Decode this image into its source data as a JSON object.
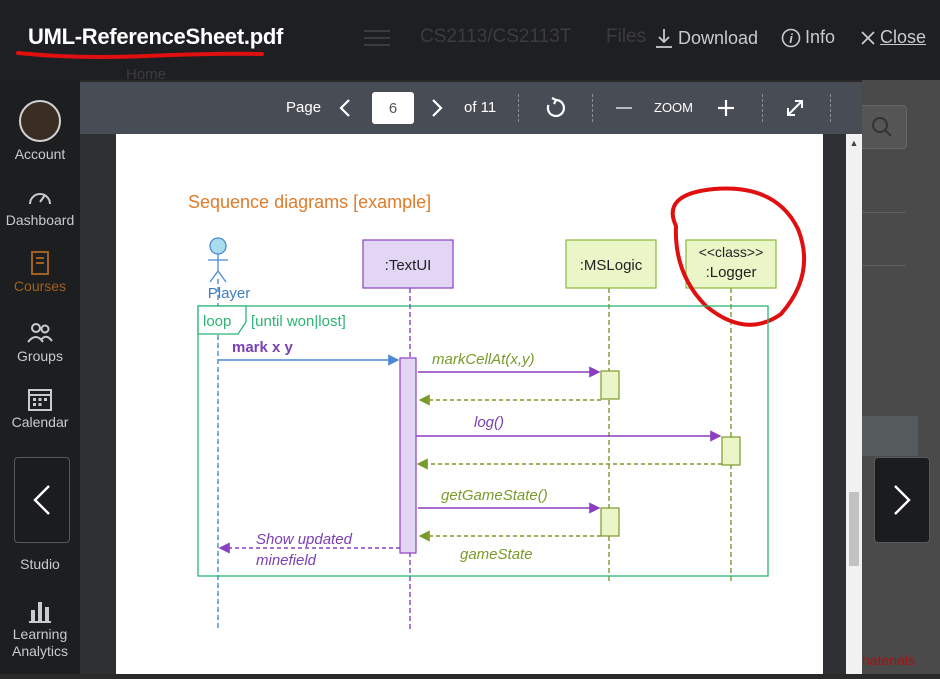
{
  "header": {
    "file_title": "UML-ReferenceSheet.pdf",
    "course_crumb": "CS2113/CS2113T",
    "crumb_files": "Files",
    "home_crumb": "Home",
    "download_label": "Download",
    "info_label": "Info",
    "close_label": "Close"
  },
  "sidebar": {
    "items": [
      {
        "label": "Account",
        "icon": "avatar-icon"
      },
      {
        "label": "Dashboard",
        "icon": "speedometer-icon"
      },
      {
        "label": "Courses",
        "icon": "book-icon"
      },
      {
        "label": "Groups",
        "icon": "people-icon"
      },
      {
        "label": "Calendar",
        "icon": "calendar-icon"
      },
      {
        "label": "Studio",
        "icon": "studio-icon"
      },
      {
        "label": "Learning",
        "icon": "bar-chart-icon"
      },
      {
        "label": "Analytics",
        "icon": ""
      }
    ]
  },
  "toolbar": {
    "page_label": "Page",
    "current_page": "6",
    "of_label": "of 11",
    "zoom_label": "ZOOM"
  },
  "diagram": {
    "title": "Sequence diagrams [example]",
    "actor": "Player",
    "textui": ":TextUI",
    "mslogic": ":MSLogic",
    "logger_stereotype": "<<class>>",
    "logger": ":Logger",
    "loop_tag": "loop",
    "loop_guard": "[until won|lost]",
    "msg_mark": "mark x y",
    "msg_markcell": "markCellAt(x,y)",
    "msg_log": "log()",
    "msg_getgamestate": "getGameState()",
    "msg_gamestate": "gameState",
    "msg_show1": "Show updated",
    "msg_show2": "minefield"
  },
  "background": {
    "materials_text": "naterials"
  },
  "colors": {
    "annotation_red": "#e01010",
    "title_orange": "#e07b2a",
    "loop_green": "#2bb573",
    "activation_purple": "#7a3fb3",
    "logic_olive": "#7a9a2a"
  }
}
